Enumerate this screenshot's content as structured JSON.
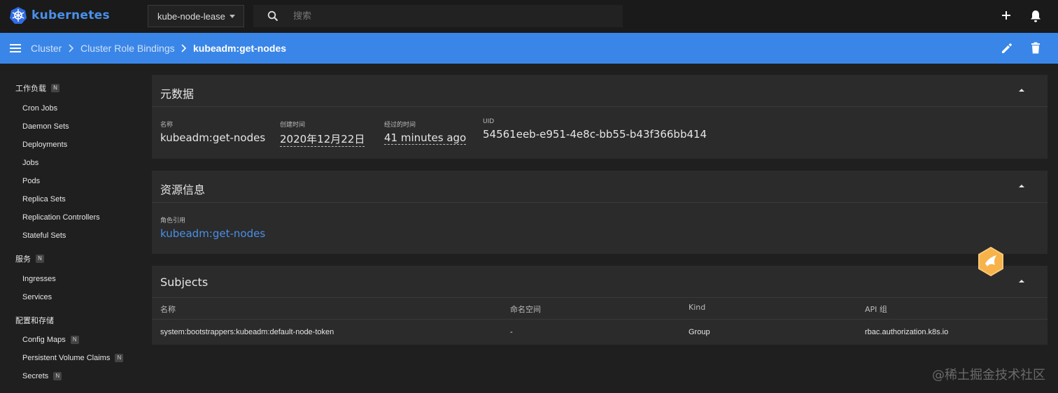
{
  "header": {
    "logo_text": "kubernetes",
    "namespace": "kube-node-lease",
    "search_placeholder": "搜索",
    "icons": {
      "logo": "kubernetes-wheel-icon",
      "search": "search-icon",
      "add": "plus-icon",
      "notifications": "bell-icon"
    }
  },
  "breadcrumb": {
    "items": [
      "Cluster",
      "Cluster Role Bindings"
    ],
    "current": "kubeadm:get-nodes",
    "icons": {
      "menu": "hamburger-icon",
      "edit": "pencil-icon",
      "delete": "trash-icon"
    }
  },
  "sidebar": {
    "workloads": {
      "label": "工作负载",
      "badge": "N"
    },
    "workload_items": [
      "Cron Jobs",
      "Daemon Sets",
      "Deployments",
      "Jobs",
      "Pods",
      "Replica Sets",
      "Replication Controllers",
      "Stateful Sets"
    ],
    "services": {
      "label": "服务",
      "badge": "N"
    },
    "service_items": [
      "Ingresses",
      "Services"
    ],
    "config": {
      "label": "配置和存储"
    },
    "config_items": [
      {
        "label": "Config Maps",
        "badge": "N"
      },
      {
        "label": "Persistent Volume Claims",
        "badge": "N"
      },
      {
        "label": "Secrets",
        "badge": "N"
      }
    ]
  },
  "metadata": {
    "title": "元数据",
    "name_label": "名称",
    "name": "kubeadm:get-nodes",
    "created_label": "创建时间",
    "created": "2020年12月22日",
    "age_label": "经过的时间",
    "age": "41 minutes ago",
    "uid_label": "UID",
    "uid": "54561eeb-e951-4e8c-bb55-b43f366bb414"
  },
  "resource": {
    "title": "资源信息",
    "role_ref_label": "角色引用",
    "role_ref": "kubeadm:get-nodes"
  },
  "subjects": {
    "title": "Subjects",
    "columns": [
      "名称",
      "命名空间",
      "Kind",
      "API 组"
    ],
    "rows": [
      [
        "system:bootstrappers:kubeadm:default-node-token",
        "-",
        "Group",
        "rbac.authorization.k8s.io"
      ]
    ]
  },
  "watermark": "@稀土掘金技术社区",
  "colors": {
    "accent": "#3a86e8",
    "link": "#4a90e8",
    "background": "#1f1f1f",
    "card": "#2b2b2b"
  }
}
